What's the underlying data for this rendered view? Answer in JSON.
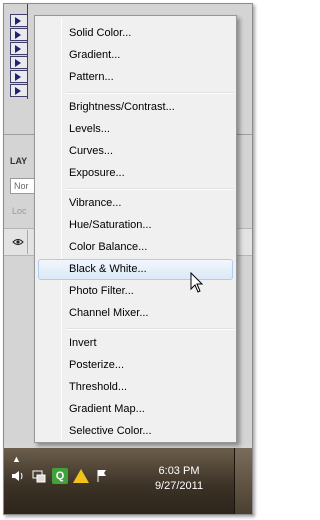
{
  "panel": {
    "layers_tab": "LAY",
    "blend_mode": "Nor",
    "lock_label": "Loc"
  },
  "menu": {
    "items": [
      {
        "label": "Solid Color..."
      },
      {
        "label": "Gradient..."
      },
      {
        "label": "Pattern..."
      },
      {
        "label": "Brightness/Contrast..."
      },
      {
        "label": "Levels..."
      },
      {
        "label": "Curves..."
      },
      {
        "label": "Exposure..."
      },
      {
        "label": "Vibrance..."
      },
      {
        "label": "Hue/Saturation..."
      },
      {
        "label": "Color Balance..."
      },
      {
        "label": "Black & White..."
      },
      {
        "label": "Photo Filter..."
      },
      {
        "label": "Channel Mixer..."
      },
      {
        "label": "Invert"
      },
      {
        "label": "Posterize..."
      },
      {
        "label": "Threshold..."
      },
      {
        "label": "Gradient Map..."
      },
      {
        "label": "Selective Color..."
      }
    ],
    "highlighted": "Black & White..."
  },
  "taskbar": {
    "time": "6:03 PM",
    "date": "9/27/2011"
  },
  "colors": {
    "menu_bg": "#f0f0f0",
    "highlight_border": "#aeccef",
    "taskbar": "#3c3226"
  }
}
